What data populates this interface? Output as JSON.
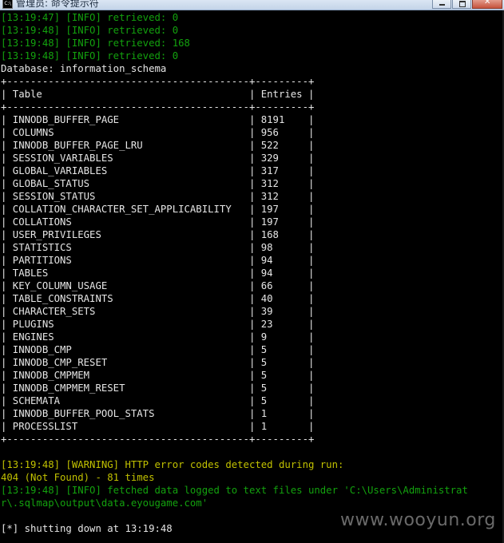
{
  "window": {
    "title": "管理员: 命令提示符",
    "icon_text": "C:\\"
  },
  "console": {
    "log_top": [
      "[13:19:47] [INFO] retrieved: 0",
      "[13:19:48] [INFO] retrieved: 0",
      "[13:19:48] [INFO] retrieved: 168",
      "[13:19:48] [INFO] retrieved: 0"
    ],
    "database_line": "Database: information_schema",
    "table_border": "+-----------------------------------------+---------+",
    "table_header": "| Table                                   | Entries |",
    "table_rows": [
      "| INNODB_BUFFER_PAGE                      | 8191    |",
      "| COLUMNS                                 | 956     |",
      "| INNODB_BUFFER_PAGE_LRU                  | 522     |",
      "| SESSION_VARIABLES                       | 329     |",
      "| GLOBAL_VARIABLES                        | 317     |",
      "| GLOBAL_STATUS                           | 312     |",
      "| SESSION_STATUS                          | 312     |",
      "| COLLATION_CHARACTER_SET_APPLICABILITY   | 197     |",
      "| COLLATIONS                              | 197     |",
      "| USER_PRIVILEGES                         | 168     |",
      "| STATISTICS                              | 98      |",
      "| PARTITIONS                              | 94      |",
      "| TABLES                                  | 94      |",
      "| KEY_COLUMN_USAGE                        | 66      |",
      "| TABLE_CONSTRAINTS                       | 40      |",
      "| CHARACTER_SETS                          | 39      |",
      "| PLUGINS                                 | 23      |",
      "| ENGINES                                 | 9       |",
      "| INNODB_CMP                              | 5       |",
      "| INNODB_CMP_RESET                        | 5       |",
      "| INNODB_CMPMEM                           | 5       |",
      "| INNODB_CMPMEM_RESET                     | 5       |",
      "| SCHEMATA                                | 5       |",
      "| INNODB_BUFFER_POOL_STATS                | 1       |",
      "| PROCESSLIST                             | 1       |"
    ],
    "warning_line": "[13:19:48] [WARNING] HTTP error codes detected during run:",
    "notfound_line": "404 (Not Found) - 81 times",
    "info_fetched_1": "[13:19:48] [INFO] fetched data logged to text files under 'C:\\Users\\Administrat",
    "info_fetched_2": "r\\.sqlmap\\output\\data.eyougame.com'",
    "shutdown_line": "[*] shutting down at 13:19:48"
  },
  "watermark": "www.wooyun.org",
  "colors": {
    "background": "#000000",
    "info_green": "#13a10e",
    "warning_yellow": "#c1c100",
    "text_white": "#e6e6e6"
  }
}
